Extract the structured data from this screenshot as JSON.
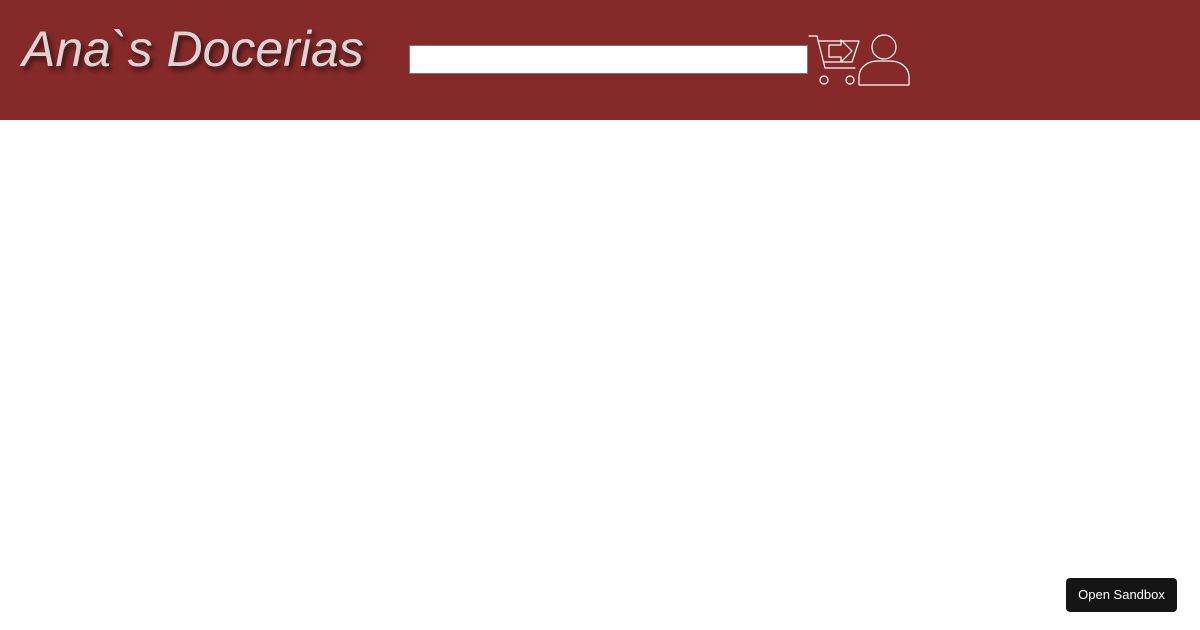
{
  "header": {
    "brand_title": "Ana`s Docerias",
    "background_color": "#852929",
    "brand_color": "#dcd3d3",
    "search": {
      "value": "",
      "placeholder": ""
    },
    "icons": {
      "cart": "shopping-cart-arrow-icon",
      "user": "user-icon"
    }
  },
  "footer_action": {
    "open_sandbox_label": "Open Sandbox"
  }
}
